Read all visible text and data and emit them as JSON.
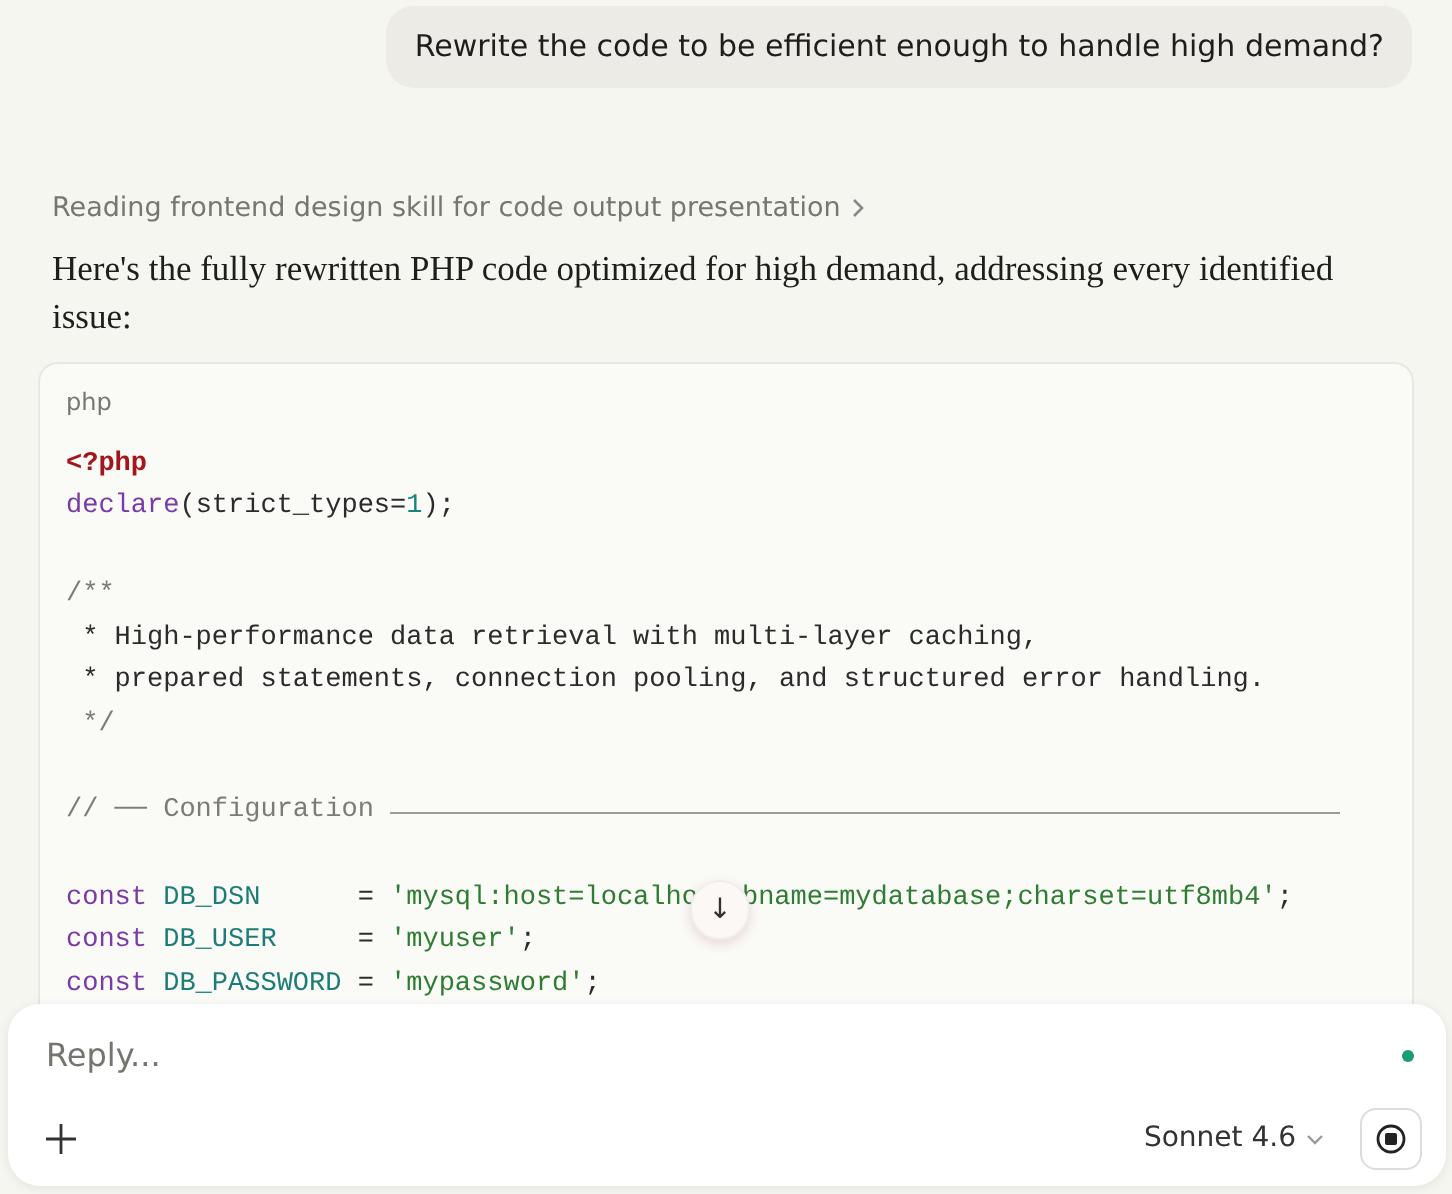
{
  "user_message": {
    "text": "Rewrite the code to be efficient enough to handle high demand?"
  },
  "status_line": {
    "text": "Reading frontend design skill for code output presentation"
  },
  "response": {
    "text": "Here's the fully rewritten PHP code optimized for high demand, addressing every identified issue:"
  },
  "code_block": {
    "language": "php",
    "lines": [
      {
        "kind": "code",
        "tokens": [
          {
            "kind": "tag",
            "text": "<?php"
          }
        ]
      },
      {
        "kind": "code",
        "tokens": [
          {
            "kind": "keyword",
            "text": "declare"
          },
          {
            "kind": "plain",
            "text": "(strict_types="
          },
          {
            "kind": "number",
            "text": "1"
          },
          {
            "kind": "plain",
            "text": ");"
          }
        ]
      },
      {
        "kind": "blank"
      },
      {
        "kind": "code",
        "tokens": [
          {
            "kind": "comment",
            "text": "/**"
          }
        ]
      },
      {
        "kind": "code",
        "tokens": [
          {
            "kind": "plain",
            "text": " * High-performance data retrieval with multi-layer caching,"
          }
        ]
      },
      {
        "kind": "code",
        "tokens": [
          {
            "kind": "plain",
            "text": " * prepared statements, connection pooling, and structured error handling."
          }
        ]
      },
      {
        "kind": "code",
        "tokens": [
          {
            "kind": "comment",
            "text": " */"
          }
        ]
      },
      {
        "kind": "blank"
      },
      {
        "kind": "section",
        "tokens": [
          {
            "kind": "comment",
            "text": "// ── Configuration"
          }
        ]
      },
      {
        "kind": "blank"
      },
      {
        "kind": "code",
        "tokens": [
          {
            "kind": "keyword",
            "text": "const "
          },
          {
            "kind": "constant",
            "text": "DB_DSN      "
          },
          {
            "kind": "plain",
            "text": "= "
          },
          {
            "kind": "string",
            "text": "'mysql:host=localho"
          },
          {
            "kind": "scroll_button",
            "text": "↓"
          },
          {
            "kind": "string",
            "text": "bname=mydatabase;charset=utf8mb4'"
          },
          {
            "kind": "plain",
            "text": ";"
          }
        ]
      },
      {
        "kind": "code",
        "tokens": [
          {
            "kind": "keyword",
            "text": "const "
          },
          {
            "kind": "constant",
            "text": "DB_USER     "
          },
          {
            "kind": "plain",
            "text": "= "
          },
          {
            "kind": "string",
            "text": "'myuser'"
          },
          {
            "kind": "plain",
            "text": ";"
          }
        ]
      },
      {
        "kind": "code",
        "tokens": [
          {
            "kind": "keyword",
            "text": "const "
          },
          {
            "kind": "constant",
            "text": "DB_PASSWORD "
          },
          {
            "kind": "plain",
            "text": "= "
          },
          {
            "kind": "string",
            "text": "'mypassword'"
          },
          {
            "kind": "plain",
            "text": ";"
          }
        ]
      }
    ]
  },
  "composer": {
    "placeholder": "Reply...",
    "model": "Sonnet 4.6"
  }
}
